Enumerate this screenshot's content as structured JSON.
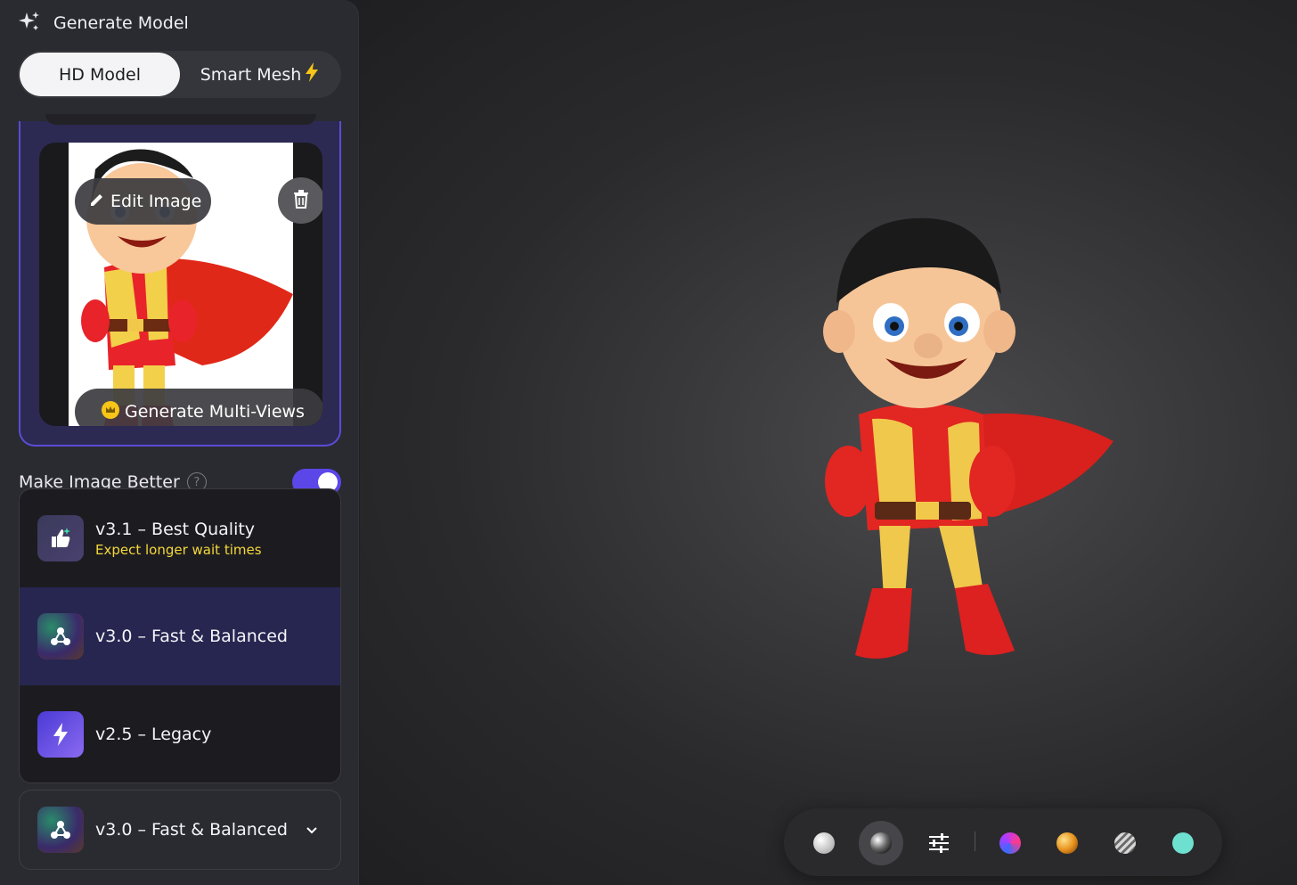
{
  "header": {
    "title": "Generate Model",
    "icon": "sparkle-icon"
  },
  "mode_tabs": {
    "hd_label": "HD Model",
    "smart_label": "Smart Mesh",
    "smart_badge_icon": "lightning-icon"
  },
  "image_card": {
    "edit_label": "Edit Image",
    "multiview_label": "Generate Multi-Views",
    "multiview_icon": "crown-icon",
    "delete_icon": "trash-icon"
  },
  "enhance": {
    "label": "Make Image Better",
    "enabled": true
  },
  "model_options": [
    {
      "title": "v3.1 – Best Quality",
      "subtitle": "Expect longer wait times",
      "icon": "thumbs-up-icon"
    },
    {
      "title": "v3.0 – Fast & Balanced",
      "icon": "network-icon",
      "selected": true
    },
    {
      "title": "v2.5 – Legacy",
      "icon": "lightning-icon"
    }
  ],
  "model_select": {
    "value": "v3.0 – Fast & Balanced",
    "icon": "network-icon"
  },
  "toolbar": {
    "items": [
      "white-matte-sphere",
      "chrome-sphere",
      "sliders-icon",
      "gradient-sphere",
      "orange-sphere",
      "gray-sphere",
      "teal-sphere"
    ]
  },
  "colors": {
    "accent": "#5b47e8",
    "warning_text": "#f5d73a",
    "selected_bg": "#272650"
  }
}
